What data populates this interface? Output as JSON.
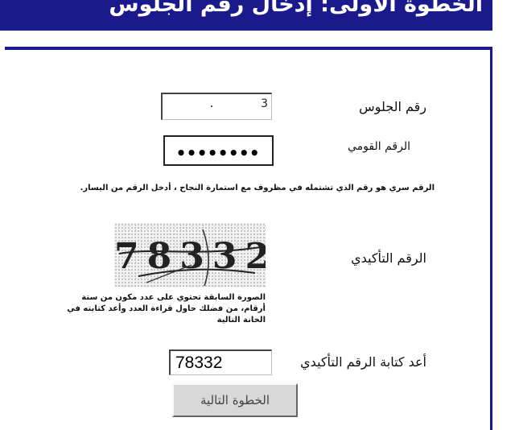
{
  "header": {
    "title": "الخطوة الأولى: إدخال رقم الجلوس",
    "color": "#1a1a8c"
  },
  "form": {
    "seat_number": {
      "label": "رقم الجلوس",
      "value": "3"
    },
    "national_id": {
      "label": "الرقم القومي",
      "masked_value": "••••••••"
    },
    "secret_note": "الرقم سري هو رقم الذي تشتمله في مظروف مع استمارة النجاح ، أدخل الرقم من اليسار.",
    "captcha": {
      "label": "الرقم التأكيدي",
      "image_text": "78332",
      "description": "الصورة السابقة تحتوي على عدد مكون من ستة أرقام، من فضلك حاول قراءة العدد وأعد كتابته في الخانة التالية"
    },
    "confirm": {
      "label": "أعد كتابة الرقم التأكيدي",
      "value": "78332"
    },
    "next_button_label": "الخطوة التالية"
  }
}
